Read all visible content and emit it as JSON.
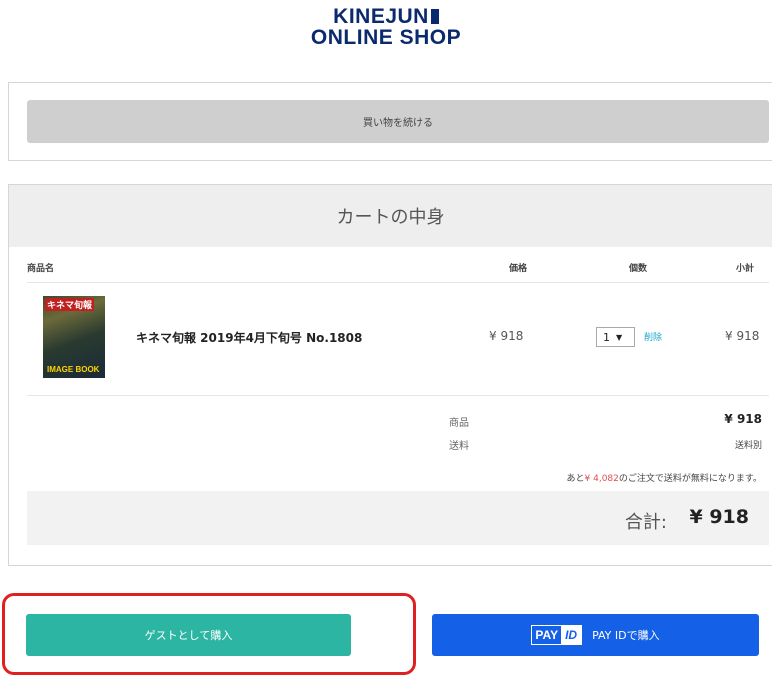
{
  "logo": {
    "line1": "KINEJUN",
    "line2": "ONLINE SHOP"
  },
  "continue_button": "買い物を続ける",
  "cart": {
    "title": "カートの中身",
    "columns": {
      "name": "商品名",
      "price": "価格",
      "qty": "個数",
      "subtotal": "小計"
    },
    "items": [
      {
        "thumb_title": "キネマ旬報",
        "thumb_subtitle": "IMAGE BOOK",
        "name": "キネマ旬報 2019年4月下旬号 No.1808",
        "price": "¥ 918",
        "qty": "1",
        "qty_arrow": "▼",
        "delete_label": "削除",
        "subtotal": "¥ 918"
      }
    ],
    "summary": {
      "goods_label": "商品",
      "goods_value": "¥ 918",
      "shipping_label": "送料",
      "shipping_value": "送料別",
      "note_prefix": "あと",
      "note_amount": "¥ 4,082",
      "note_suffix": "のご注文で送料が無料になります。"
    },
    "total_label": "合計:",
    "total_value": "¥ 918"
  },
  "buttons": {
    "guest": "ゲストとして購入",
    "payid_logo_a": "PAY",
    "payid_logo_b": "ID",
    "payid": "PAY IDで購入"
  },
  "colors": {
    "guest_button": "#2bb5a2",
    "payid_button": "#1460e6",
    "highlight_frame": "#e02020",
    "logo": "#0b2a6e"
  }
}
